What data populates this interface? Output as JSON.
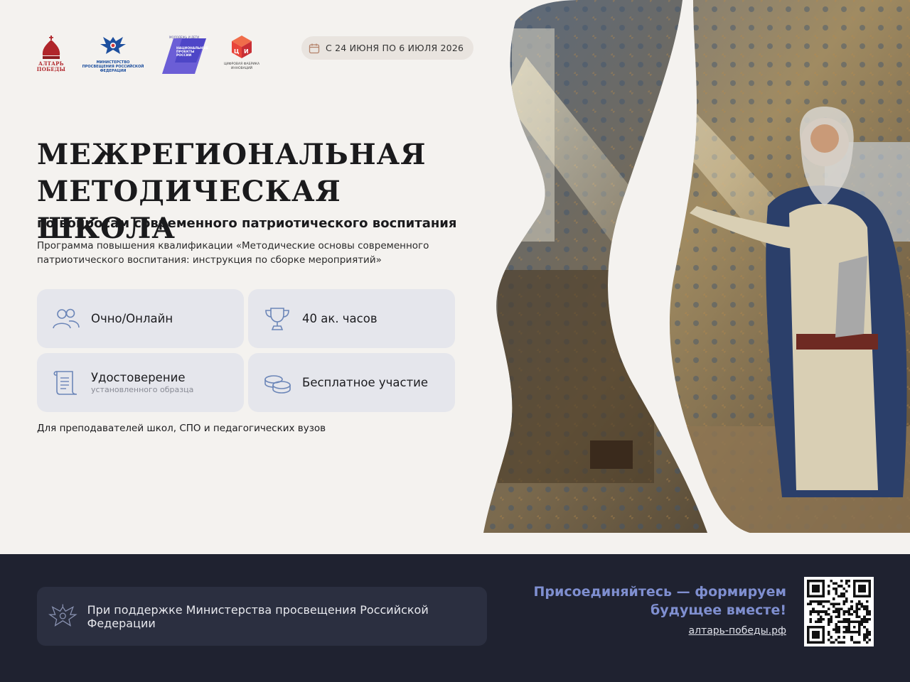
{
  "logos": {
    "altar": "АЛТАРЬ ПОБЕДЫ",
    "minpros": "МИНИСТЕРСТВО ПРОСВЕЩЕНИЯ РОССИЙСКОЙ ФЕДЕРАЦИИ",
    "natproj_caption": "МОЛОДЕЖЬ И ДЕТИ",
    "natproj": "НАЦИОНАЛЬНЫЕ ПРОЕКТЫ РОССИИ",
    "cfi": "ЦИФРОВАЯ ФАБРИКА ИННОВАЦИЙ"
  },
  "date": {
    "icon": "calendar-icon",
    "text": "С 24 ИЮНЯ ПО 6 ИЮЛЯ 2026"
  },
  "title": {
    "line1": "МЕЖРЕГИОНАЛЬНАЯ",
    "line2": "МЕТОДИЧЕСКАЯ ШКОЛА"
  },
  "subtitle": "по вопросам современного патриотического воспитания",
  "description": "Программа повышения квалификации «Методические основы современного патриотического воспитания: инструкция по сборке мероприятий»",
  "cards": [
    {
      "icon": "people-icon",
      "label": "Очно/Онлайн",
      "sub": ""
    },
    {
      "icon": "trophy-icon",
      "label": "40 ак. часов",
      "sub": ""
    },
    {
      "icon": "scroll-icon",
      "label": "Удостоверение",
      "sub": "установленного образца"
    },
    {
      "icon": "coins-icon",
      "label": "Бесплатное участие",
      "sub": ""
    }
  ],
  "audience": "Для преподавателей школ, СПО и педагогических вузов",
  "footer": {
    "support": "При поддержке Министерства просвещения Российской Федерации",
    "join_line1": "Присоединяйтесь — формируем",
    "join_line2": "будущее вместе!",
    "url": "алтарь-победы.рф"
  },
  "colors": {
    "accent": "#7f8fd0",
    "footer_bg": "#1f2230",
    "card_bg": "#e5e6ec",
    "page_bg": "#f4f2ef"
  }
}
